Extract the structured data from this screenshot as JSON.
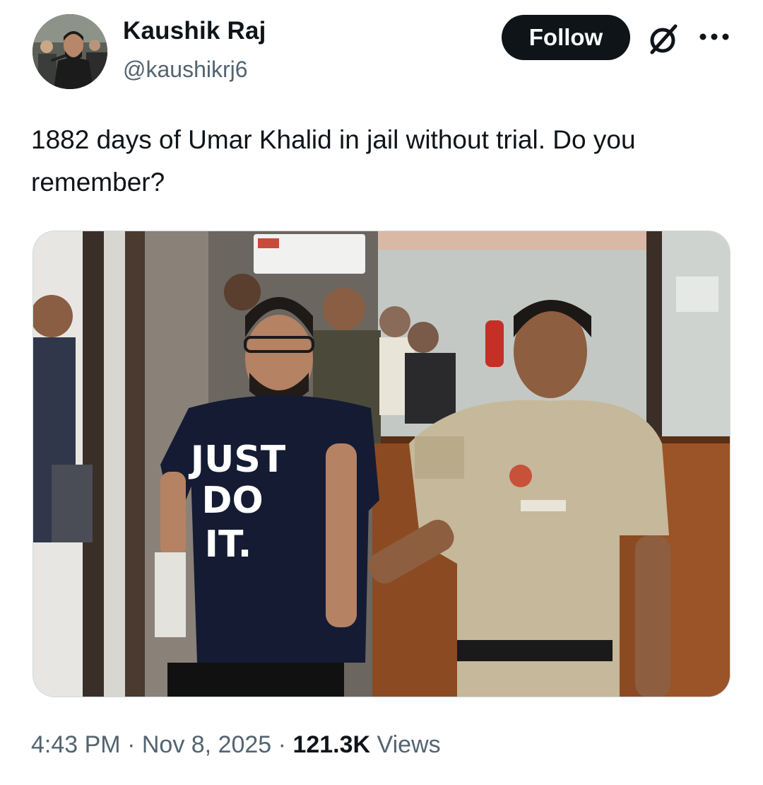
{
  "author": {
    "display_name": "Kaushik Raj",
    "handle": "@kaushikrj6"
  },
  "actions": {
    "follow_label": "Follow",
    "grok_icon": "grok-icon",
    "more_icon": "more-icon"
  },
  "tweet": {
    "text": "1882 days of Umar Khalid in jail without trial. Do you remember?",
    "media": {
      "shirt_text_line1": "JUST",
      "shirt_text_line2": "DO",
      "shirt_text_line3": "IT."
    }
  },
  "meta": {
    "time": "4:43 PM",
    "separator": "·",
    "date": "Nov 8, 2025",
    "views_count": "121.3K",
    "views_label": "Views"
  },
  "colors": {
    "text_primary": "#0f1419",
    "text_secondary": "#536471",
    "follow_bg": "#0f1419",
    "border": "#cfd9de"
  }
}
